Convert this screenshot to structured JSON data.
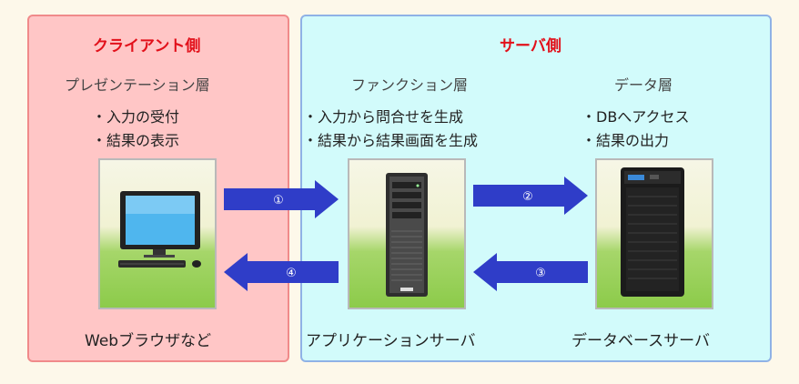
{
  "client_side": {
    "title": "クライアント側",
    "tier": "プレゼンテーション層",
    "items": [
      "・入力の受付",
      "・結果の表示"
    ],
    "caption": "Webブラウザなど"
  },
  "server_side": {
    "title": "サーバ側",
    "function_tier": {
      "title": "ファンクション層",
      "items": [
        "・入力から問合せを生成",
        "・結果から結果画面を生成"
      ],
      "caption": "アプリケーションサーバ"
    },
    "data_tier": {
      "title": "データ層",
      "items": [
        "・DBへアクセス",
        "・結果の出力"
      ],
      "caption": "データベースサーバ"
    }
  },
  "arrows": [
    "①",
    "②",
    "③",
    "④"
  ],
  "colors": {
    "client_bg": "#ffc6c6",
    "client_border": "#f08a8a",
    "server_bg": "#d2fbfb",
    "server_border": "#8fb2e6",
    "title_red": "#e2101a",
    "arrow_blue": "#2f3dc8",
    "grass_green": "#8ccb4a"
  }
}
